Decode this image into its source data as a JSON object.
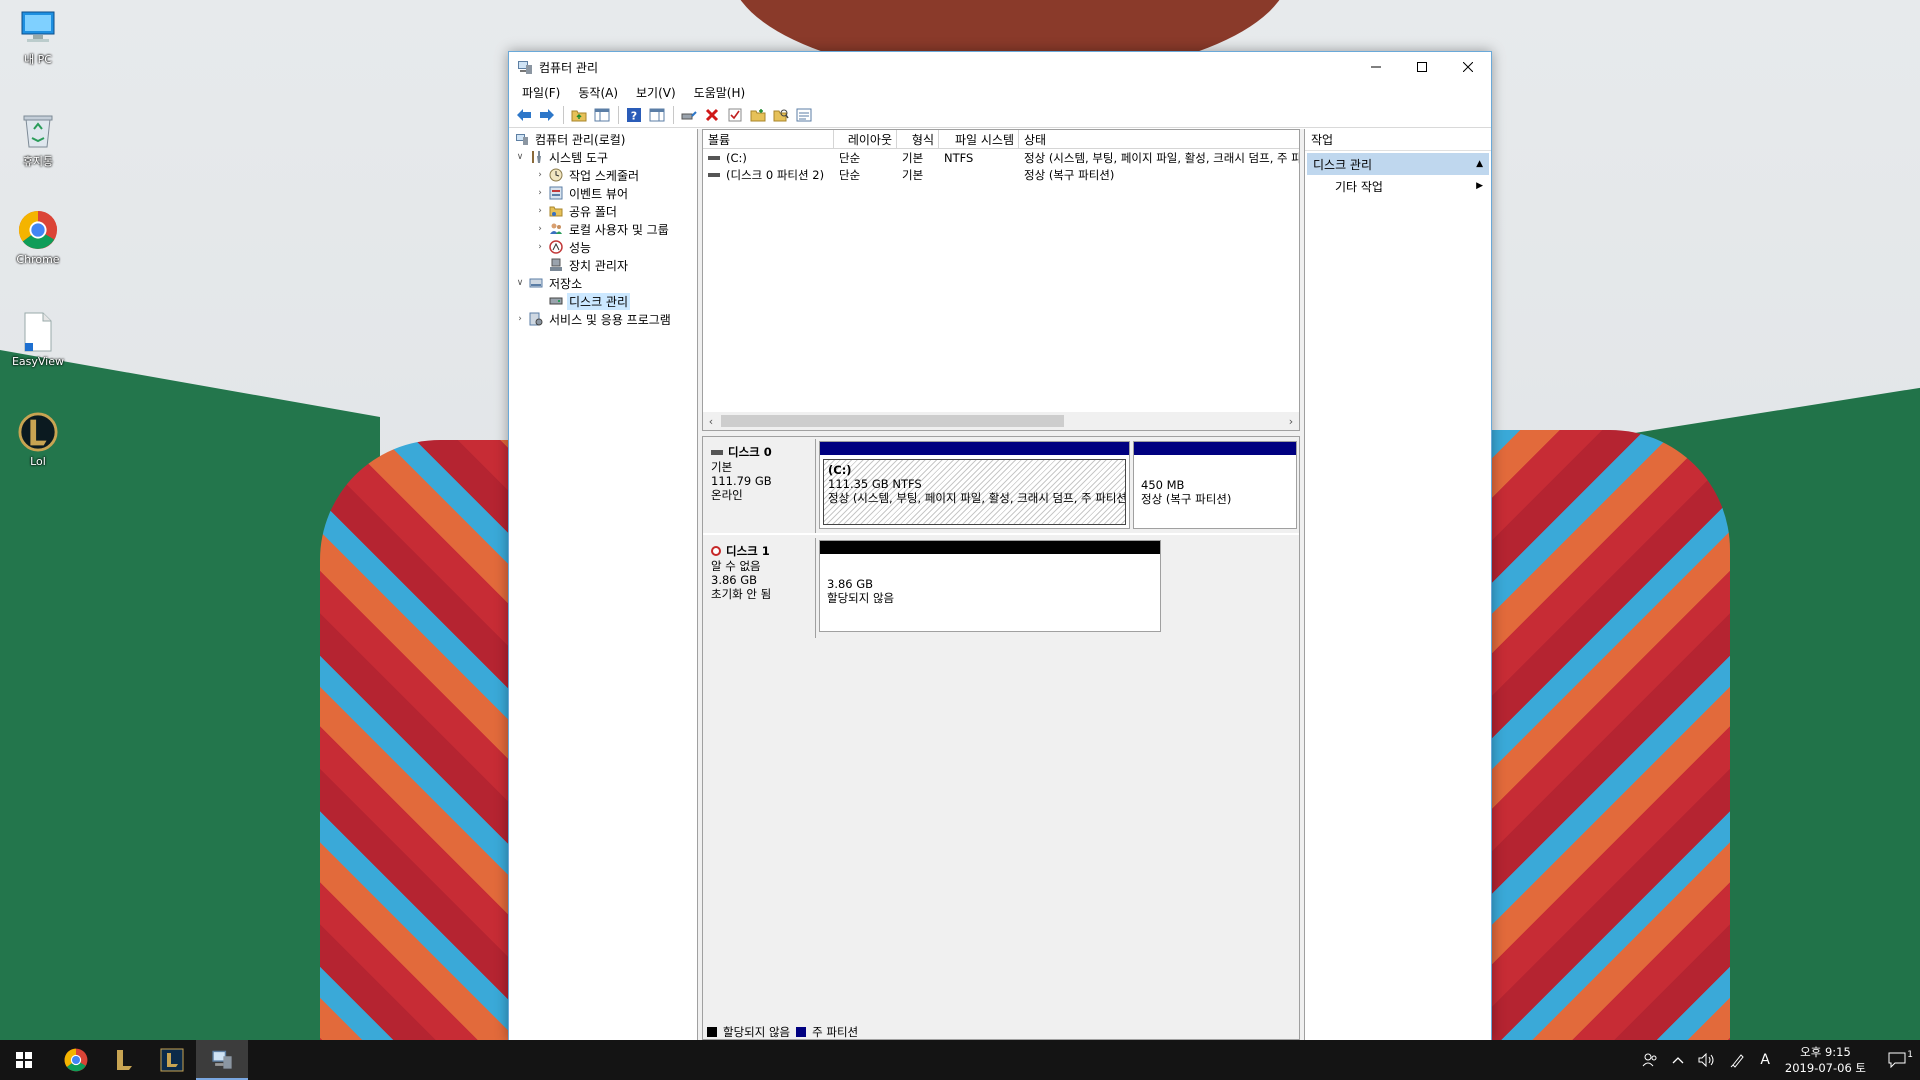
{
  "desktop": {
    "icons": [
      {
        "label": "내 PC",
        "icon": "pc-icon"
      },
      {
        "label": "휴지통",
        "icon": "recycle-bin-icon"
      },
      {
        "label": "Chrome",
        "icon": "chrome-icon"
      },
      {
        "label": "EasyView",
        "icon": "document-icon"
      },
      {
        "label": "Lol",
        "icon": "league-icon"
      }
    ]
  },
  "window": {
    "title": "컴퓨터 관리",
    "menu": [
      "파일(F)",
      "동작(A)",
      "보기(V)",
      "도움말(H)"
    ]
  },
  "tree": {
    "root": "컴퓨터 관리(로컬)",
    "system_tools": "시스템 도구",
    "task_scheduler": "작업 스케줄러",
    "event_viewer": "이벤트 뷰어",
    "shared_folders": "공유 폴더",
    "local_users": "로컬 사용자 및 그룹",
    "performance": "성능",
    "device_manager": "장치 관리자",
    "storage": "저장소",
    "disk_management": "디스크 관리",
    "services": "서비스 및 응용 프로그램"
  },
  "volumes": {
    "headers": [
      "볼륨",
      "레이아웃",
      "형식",
      "파일 시스템",
      "상태"
    ],
    "rows": [
      {
        "volume": "(C:)",
        "layout": "단순",
        "type": "기본",
        "fs": "NTFS",
        "status": "정상 (시스템, 부팅, 페이지 파일, 활성, 크래시 덤프, 주 파티션)"
      },
      {
        "volume": "(디스크 0 파티션 2)",
        "layout": "단순",
        "type": "기본",
        "fs": "",
        "status": "정상 (복구 파티션)"
      }
    ]
  },
  "disks": {
    "disk0": {
      "name": "디스크 0",
      "kind": "기본",
      "size": "111.79 GB",
      "state": "온라인",
      "p1": {
        "name": "(C:)",
        "size": "111.35 GB NTFS",
        "status": "정상 (시스템, 부팅, 페이지 파일, 활성, 크래시 덤프, 주 파티션)"
      },
      "p2": {
        "size": "450 MB",
        "status": "정상 (복구 파티션)"
      }
    },
    "disk1": {
      "name": "디스크 1",
      "kind": "알 수 없음",
      "size": "3.86 GB",
      "state": "초기화 안 됨",
      "p1": {
        "size": "3.86 GB",
        "status": "할당되지 않음"
      }
    }
  },
  "legend": {
    "unallocated": "할당되지 않음",
    "primary": "주 파티션"
  },
  "actions": {
    "header": "작업",
    "section": "디스크 관리",
    "more": "기타 작업"
  },
  "taskbar": {
    "ime": "A",
    "time": "오후 9:15",
    "date": "2019-07-06 토",
    "notifications": "1"
  },
  "colors": {
    "primary_partition": "#000080",
    "unallocated": "#000000",
    "window_border": "#6aa9d9",
    "selection": "#cce8ff"
  }
}
